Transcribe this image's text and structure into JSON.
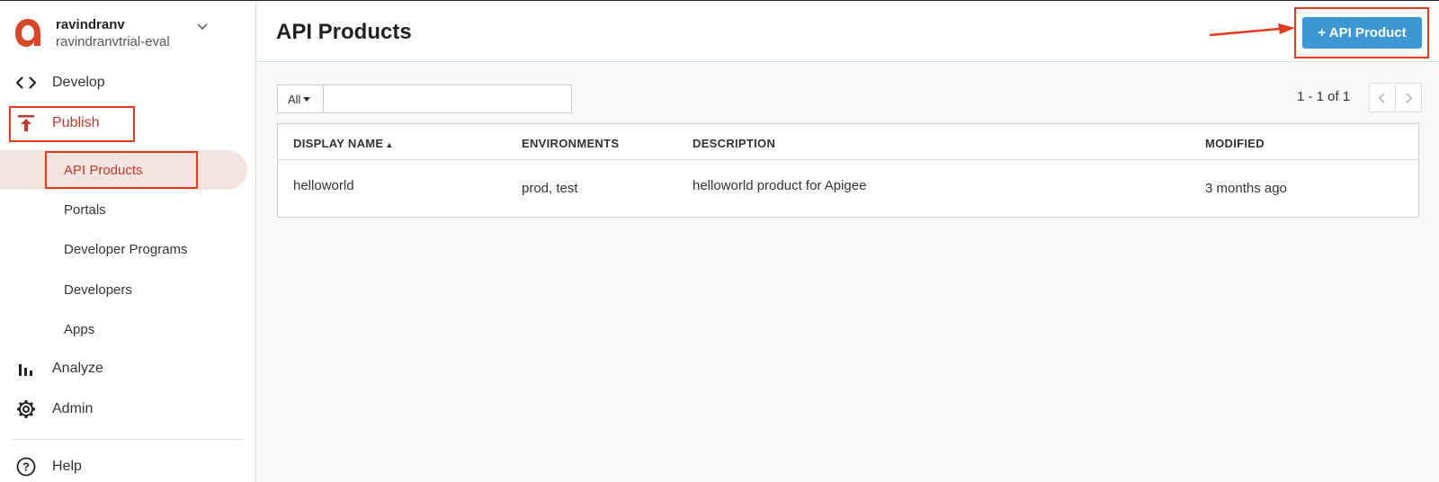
{
  "org": {
    "user": "ravindranv",
    "name": "ravindranvtrial-eval"
  },
  "nav": {
    "develop": "Develop",
    "publish": "Publish",
    "analyze": "Analyze",
    "admin": "Admin",
    "help": "Help"
  },
  "publish_sub": {
    "api_products": "API Products",
    "portals": "Portals",
    "developer_programs": "Developer Programs",
    "developers": "Developers",
    "apps": "Apps"
  },
  "header": {
    "title": "API Products",
    "add_button": "+ API Product"
  },
  "filter": {
    "select_value": "All",
    "search_value": ""
  },
  "pager": {
    "text": "1 - 1 of 1"
  },
  "table": {
    "columns": {
      "display_name": "DISPLAY NAME",
      "sort_indicator": "▲",
      "environments": "ENVIRONMENTS",
      "description": "DESCRIPTION",
      "modified": "MODIFIED"
    },
    "rows": [
      {
        "display_name": "helloworld",
        "environments": "prod, test",
        "description": "helloworld product for Apigee",
        "modified": "3 months ago"
      }
    ]
  },
  "colors": {
    "accent": "#c0392b",
    "button": "#3c97d3",
    "annotation": "#e63a1e",
    "active_bg": "#f3e4e0"
  },
  "icons": {
    "logo": "apigee-logo-icon",
    "develop": "code-brackets-icon",
    "publish": "upload-icon",
    "analyze": "bar-chart-icon",
    "admin": "gear-icon",
    "help": "help-circle-icon"
  }
}
